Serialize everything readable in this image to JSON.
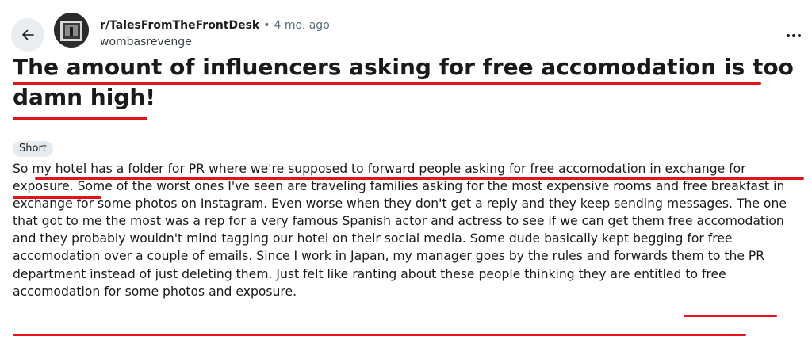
{
  "header": {
    "back_label": "Back",
    "subreddit": "r/TalesFromTheFrontDesk",
    "separator": "•",
    "time": "4 mo. ago",
    "author": "wombasrevenge"
  },
  "post": {
    "title": "The amount of influencers asking for free accomodation is too damn high!",
    "flair": "Short",
    "body": "So my hotel has a folder for PR where we're supposed to forward people asking for free accomodation in exchange for exposure. Some of the worst ones I've seen are traveling families asking for the most expensive rooms and free breakfast in exchange for some photos on Instagram. Even worse when they don't get a reply and they keep sending messages. The one that got to me the most was a rep for a very famous Spanish actor and actress to see if we can get them free accomodation and they probably wouldn't mind tagging our hotel on their social media. Some dude basically kept begging for free accomodation over a couple of emails. Since I work in Japan, my manager goes by the rules and forwards them to the PR department instead of just deleting them. Just felt like ranting about these people thinking they are entitled to free accomodation for some photos and exposure."
  },
  "icons": {
    "back": "arrow-left-icon",
    "more": "more-horizontal-icon",
    "avatar": "subreddit-avatar"
  },
  "colors": {
    "underline": "#e3131b",
    "back_bg": "#eaedef",
    "flair_bg": "#e5ebee",
    "meta_gray": "#576f76"
  }
}
